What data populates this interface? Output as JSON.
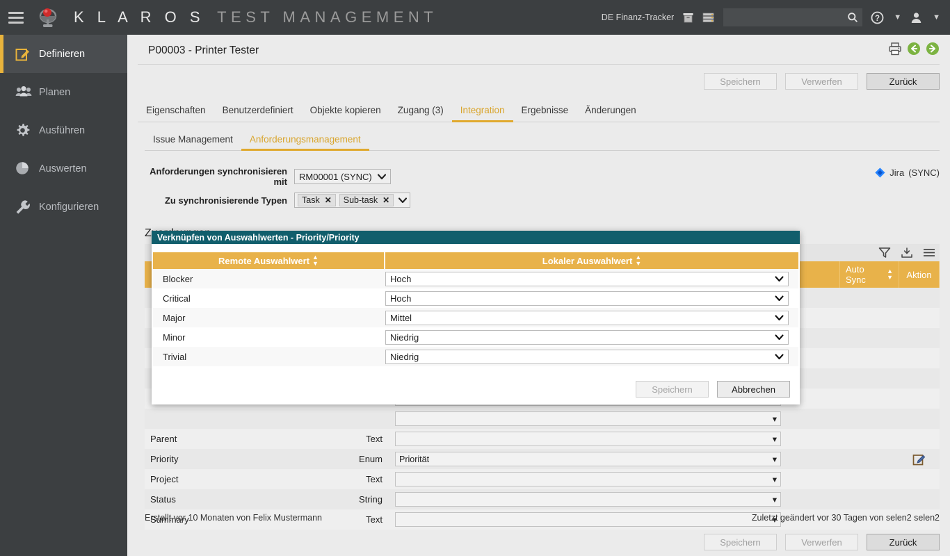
{
  "topbar": {
    "menu_icon": "hamburger-icon",
    "logo_icon": "klaros-satellite-logo",
    "brand_primary": "K L A R O S",
    "brand_secondary": "TEST MANAGEMENT",
    "project_label": "DE Finanz-Tracker",
    "icon1": "archive-box-icon",
    "icon2": "server-stack-icon",
    "search_value": "",
    "search_placeholder": "",
    "search_icon": "search-icon",
    "help_icon": "help-circle-icon",
    "user_icon": "user-icon"
  },
  "sidebar": {
    "items": [
      {
        "label": "Definieren",
        "icon": "edit-square-icon",
        "active": true
      },
      {
        "label": "Planen",
        "icon": "users-group-icon",
        "active": false
      },
      {
        "label": "Ausführen",
        "icon": "gear-icon",
        "active": false
      },
      {
        "label": "Auswerten",
        "icon": "pie-chart-icon",
        "active": false
      },
      {
        "label": "Konfigurieren",
        "icon": "wrench-icon",
        "active": false
      }
    ]
  },
  "page": {
    "title": "P00003 - Printer Tester",
    "head_icons": [
      "printer-icon",
      "previous-arrow-icon",
      "next-arrow-icon"
    ]
  },
  "actions": {
    "save": "Speichern",
    "discard": "Verwerfen",
    "back": "Zurück"
  },
  "tabs": [
    {
      "label": "Eigenschaften",
      "active": false
    },
    {
      "label": "Benutzerdefiniert",
      "active": false
    },
    {
      "label": "Objekte kopieren",
      "active": false
    },
    {
      "label": "Zugang (3)",
      "active": false
    },
    {
      "label": "Integration",
      "active": true
    },
    {
      "label": "Ergebnisse",
      "active": false
    },
    {
      "label": "Änderungen",
      "active": false
    }
  ],
  "subtabs": [
    {
      "label": "Issue Management",
      "active": false
    },
    {
      "label": "Anforderungsmanagement",
      "active": true
    }
  ],
  "form": {
    "sync_with_label": "Anforderungen synchronisieren mit",
    "sync_with_value": "RM00001 (SYNC)",
    "types_label": "Zu synchronisierende Typen",
    "types_chips": [
      "Task",
      "Sub-task"
    ],
    "jira_icon": "jira-diamond-icon",
    "jira_name": "Jira",
    "jira_state": "(SYNC)"
  },
  "mappings": {
    "section_title": "Zuordnungen",
    "toolbar_icons": [
      "filter-icon",
      "download-icon",
      "menu-list-icon"
    ],
    "columns": [
      "",
      "",
      "",
      "",
      "Auto Sync",
      "Aktion"
    ],
    "auto_sync_header": "Auto Sync",
    "aktion_header": "Aktion",
    "rows": [
      {
        "name": "Parent",
        "type": "Text",
        "value": "",
        "action": ""
      },
      {
        "name": "Priority",
        "type": "Enum",
        "value": "Priorität",
        "action": "edit-icon"
      },
      {
        "name": "Project",
        "type": "Text",
        "value": "",
        "action": ""
      },
      {
        "name": "Status",
        "type": "String",
        "value": "",
        "action": ""
      },
      {
        "name": "Summary",
        "type": "Text",
        "value": "",
        "action": ""
      }
    ],
    "hidden_rows_count": 7
  },
  "modal": {
    "title": "Verknüpfen von Auswahlwerten - Priority/Priority",
    "col_remote": "Remote Auswahlwert",
    "col_local": "Lokaler Auswahlwert",
    "rows": [
      {
        "remote": "Blocker",
        "local": "Hoch"
      },
      {
        "remote": "Critical",
        "local": "Hoch"
      },
      {
        "remote": "Major",
        "local": "Mittel"
      },
      {
        "remote": "Minor",
        "local": "Niedrig"
      },
      {
        "remote": "Trivial",
        "local": "Niedrig"
      }
    ],
    "save_label": "Speichern",
    "cancel_label": "Abbrechen"
  },
  "footer": {
    "created": "Erstellt vor 10 Monaten von Felix Mustermann",
    "modified": "Zuletzt geändert vor 30 Tagen von selen2 selen2"
  },
  "colors": {
    "accent": "#e0a92e",
    "header_amber": "#e8b24a",
    "modal_teal": "#115e6c",
    "dark_chrome": "#3c3f41",
    "jira_blue": "#2684ff",
    "nav_green": "#7cb342"
  }
}
